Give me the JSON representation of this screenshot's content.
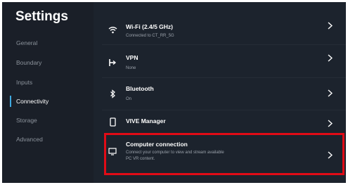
{
  "sidebar": {
    "title": "Settings",
    "items": [
      {
        "label": "General"
      },
      {
        "label": "Boundary"
      },
      {
        "label": "Inputs"
      },
      {
        "label": "Connectivity"
      },
      {
        "label": "Storage"
      },
      {
        "label": "Advanced"
      }
    ],
    "active": "Connectivity",
    "accent_color": "#3fa9e0"
  },
  "connectivity": {
    "rows": [
      {
        "icon": "wifi-icon",
        "title": "Wi-Fi (2.4/5 GHz)",
        "subtitle": "Connected to CT_RR_5G"
      },
      {
        "icon": "vpn-icon",
        "title": "VPN",
        "subtitle": "None"
      },
      {
        "icon": "bluetooth-icon",
        "title": "Bluetooth",
        "subtitle": "On"
      },
      {
        "icon": "phone-icon",
        "title": "VIVE Manager",
        "subtitle": ""
      },
      {
        "icon": "monitor-icon",
        "title": "Computer connection",
        "subtitle_line1": "Connect your computer to view and stream available",
        "subtitle_line2": "PC VR content."
      }
    ]
  },
  "highlight_color": "#e10b16"
}
